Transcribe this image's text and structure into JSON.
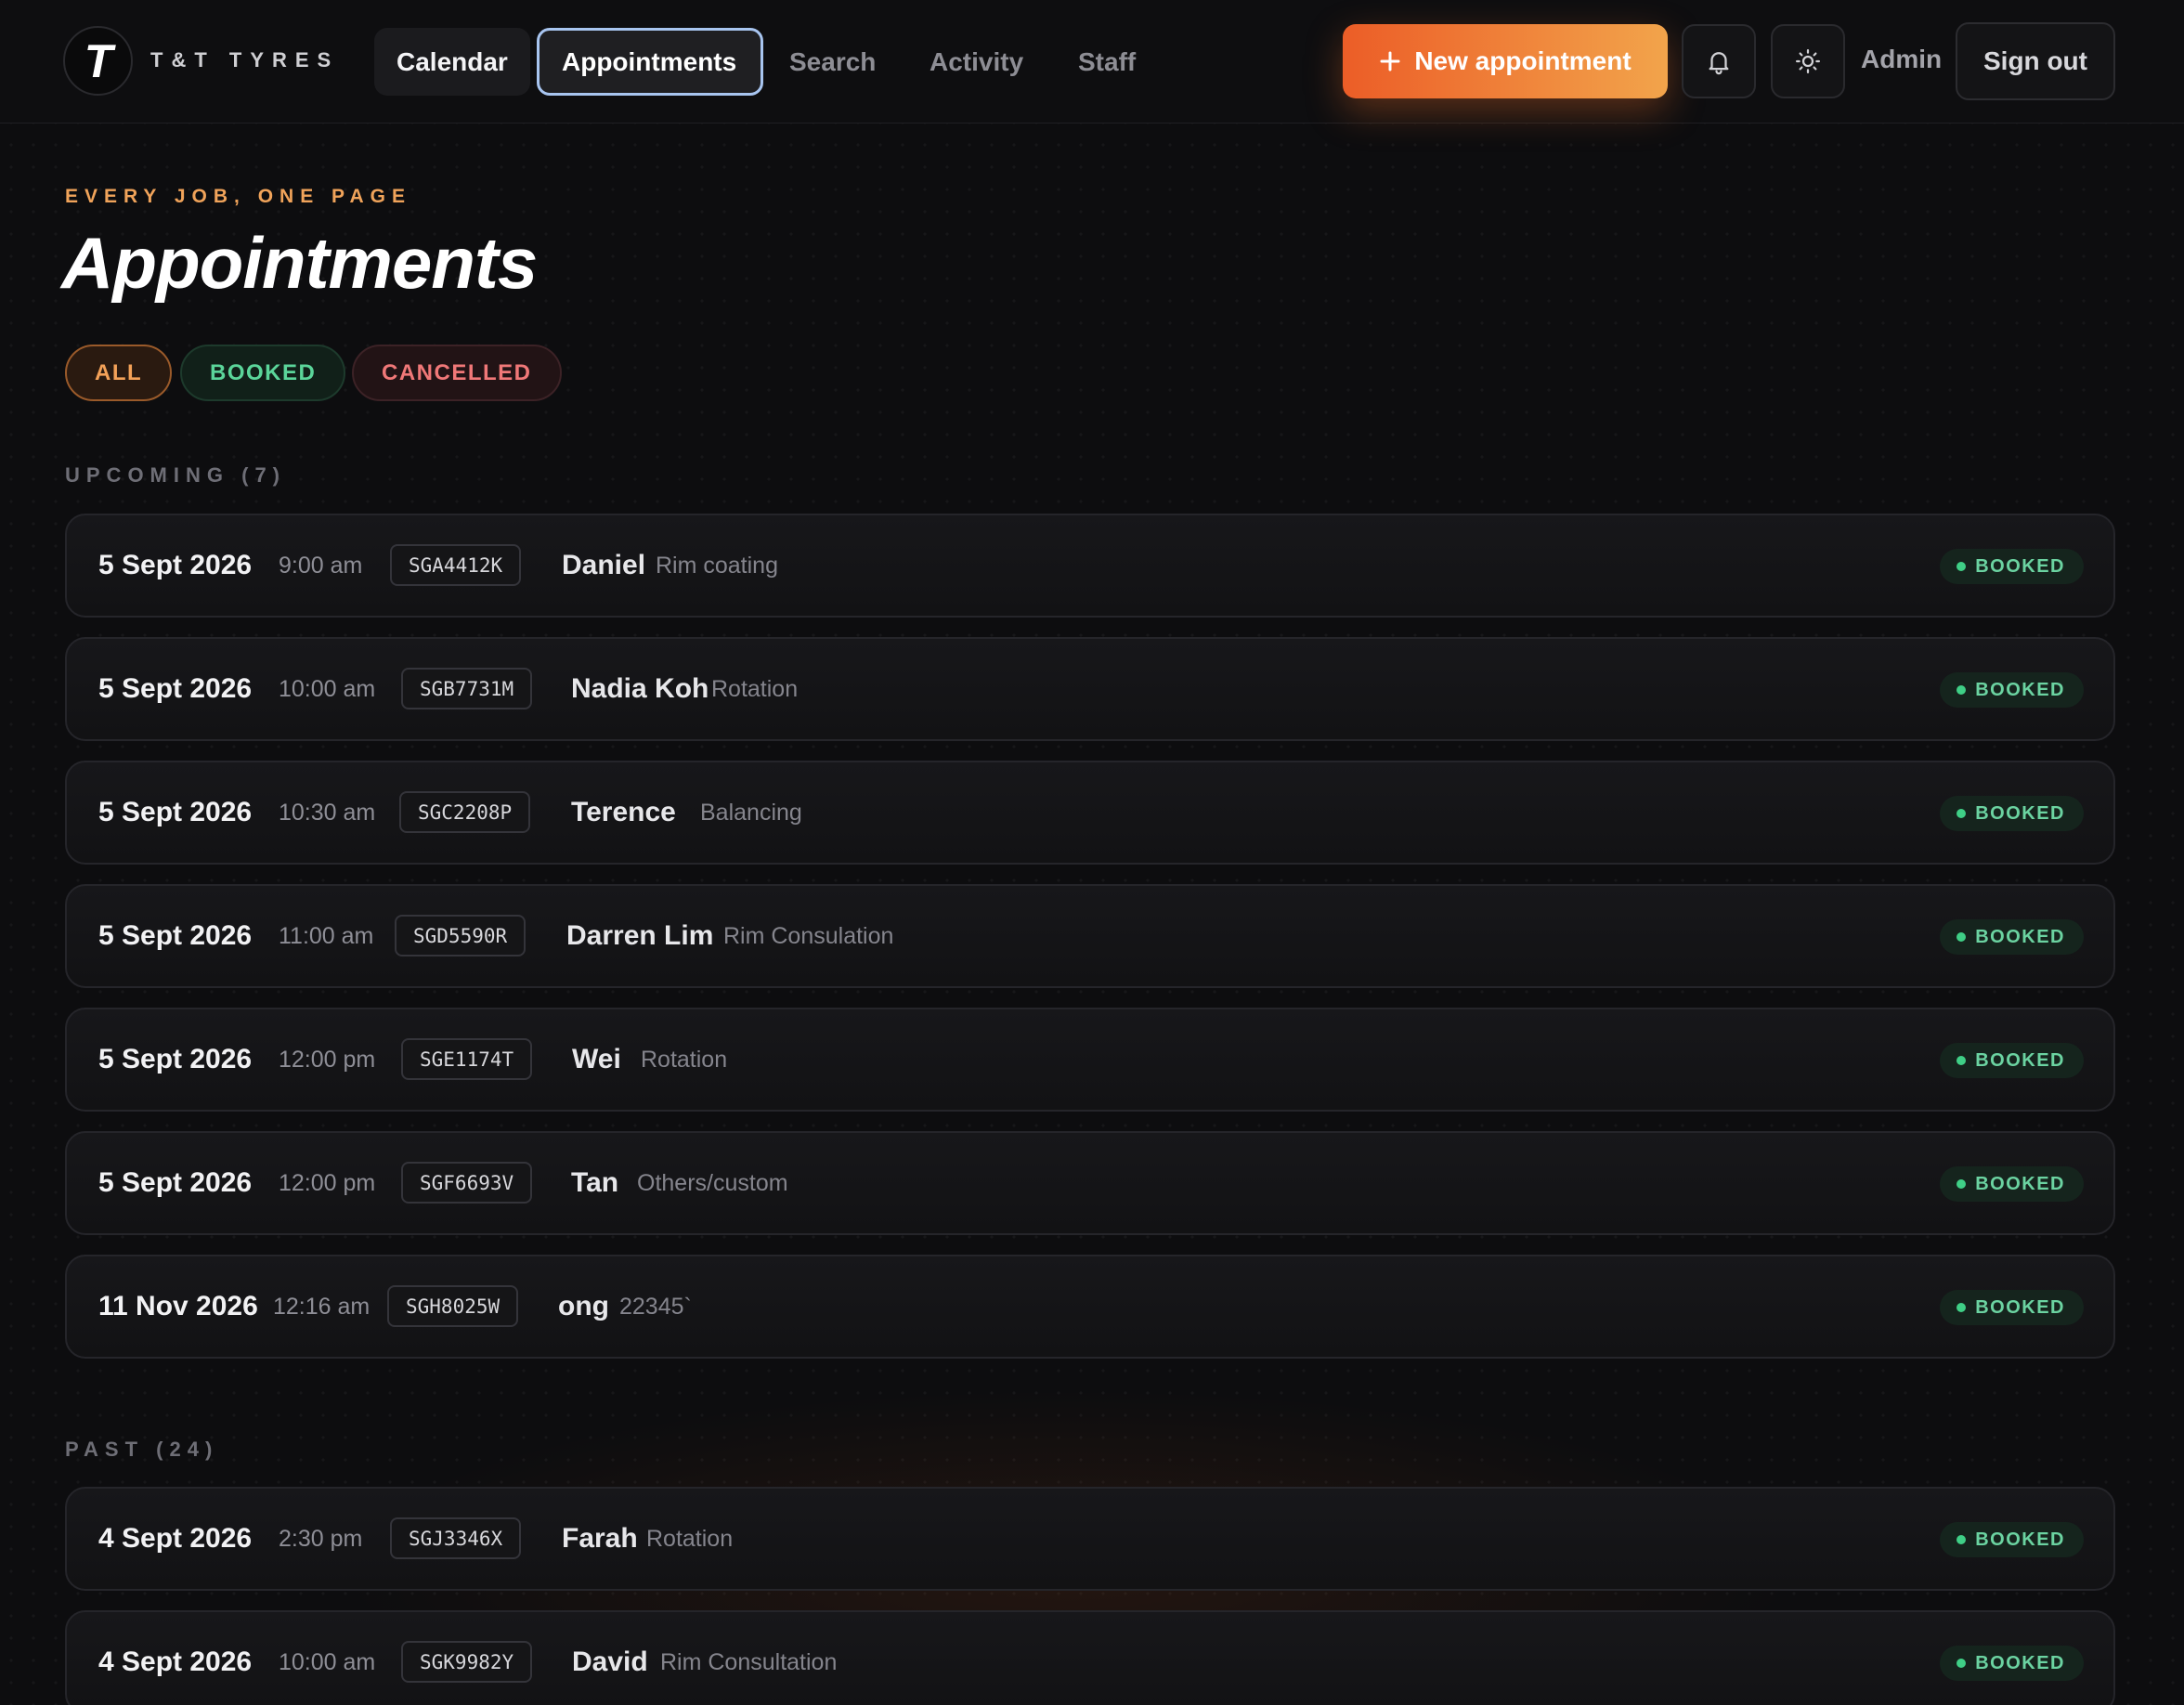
{
  "brand": {
    "logo_letter": "T",
    "name": "T&T TYRES"
  },
  "nav": {
    "calendar": "Calendar",
    "appointments": "Appointments",
    "search": "Search",
    "activity": "Activity",
    "staff": "Staff"
  },
  "header": {
    "new_appointment": "New appointment",
    "new_appointment_icon": "plus-icon",
    "notifications_icon": "bell-icon",
    "theme_icon": "sun-icon",
    "admin_label": "Admin",
    "sign_out": "Sign out"
  },
  "page": {
    "eyebrow": "EVERY JOB, ONE PAGE",
    "title": "Appointments"
  },
  "filters": {
    "all": "ALL",
    "booked": "BOOKED",
    "cancelled": "CANCELLED",
    "active": "all"
  },
  "sections": {
    "upcoming": {
      "label": "UPCOMING (7)",
      "rows": [
        {
          "date": "5 Sept 2026",
          "time": "9:00 am",
          "plate": "SGA4412K",
          "customer": "Daniel",
          "service": "Rim coating",
          "status": "BOOKED"
        },
        {
          "date": "5 Sept 2026",
          "time": "10:00 am",
          "plate": "SGB7731M",
          "customer": "Nadia Koh",
          "service": "Rotation",
          "status": "BOOKED"
        },
        {
          "date": "5 Sept 2026",
          "time": "10:30 am",
          "plate": "SGC2208P",
          "customer": "Terence",
          "service": "Balancing",
          "status": "BOOKED"
        },
        {
          "date": "5 Sept 2026",
          "time": "11:00 am",
          "plate": "SGD5590R",
          "customer": "Darren Lim",
          "service": "Rim Consulation",
          "status": "BOOKED"
        },
        {
          "date": "5 Sept 2026",
          "time": "12:00 pm",
          "plate": "SGE1174T",
          "customer": "Wei",
          "service": "Rotation",
          "status": "BOOKED"
        },
        {
          "date": "5 Sept 2026",
          "time": "12:00 pm",
          "plate": "SGF6693V",
          "customer": "Tan",
          "service": "Others/custom",
          "status": "BOOKED"
        },
        {
          "date": "11 Nov 2026",
          "time": "12:16 am",
          "plate": "SGH8025W",
          "customer": "ong",
          "service": "22345`",
          "status": "BOOKED"
        }
      ]
    },
    "past": {
      "label": "PAST (24)",
      "rows": [
        {
          "date": "4 Sept 2026",
          "time": "2:30 pm",
          "plate": "SGJ3346X",
          "customer": "Farah",
          "service": "Rotation",
          "status": "BOOKED"
        },
        {
          "date": "4 Sept 2026",
          "time": "10:00 am",
          "plate": "SGK9982Y",
          "customer": "David",
          "service": "Rim Consultation",
          "status": "BOOKED"
        }
      ]
    }
  },
  "colors": {
    "accent_orange": "#ec5d27",
    "accent_amber": "#f2a44b",
    "booked_green": "#5bd59a",
    "cancelled_red": "#f07878",
    "background": "#0d0d0f"
  }
}
